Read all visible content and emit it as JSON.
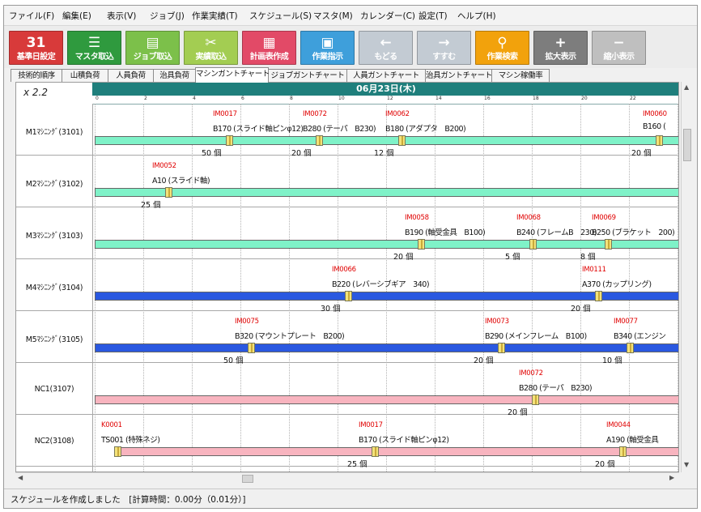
{
  "menu": [
    "ファイル(F)",
    "編集(E)",
    "表示(V)",
    "ジョブ(J)",
    "作業実績(T)",
    "スケジュール(S)",
    "マスタ(M)",
    "カレンダー(C)",
    "設定(T)",
    "ヘルプ(H)"
  ],
  "toolbar": [
    {
      "label": "基準日設定",
      "icon": "calendar-icon",
      "glyph": "31",
      "color": "#d83a3a"
    },
    {
      "label": "マスタ取込",
      "icon": "database-icon",
      "glyph": "☰",
      "color": "#2f9a3e"
    },
    {
      "label": "ジョブ取込",
      "icon": "document-icon",
      "glyph": "▤",
      "color": "#7cc04a"
    },
    {
      "label": "実績取込",
      "icon": "tools-icon",
      "glyph": "✂",
      "color": "#a3cd52"
    },
    {
      "label": "計画表作成",
      "icon": "gantt-icon",
      "glyph": "▦",
      "color": "#e24a67"
    },
    {
      "label": "作業指示",
      "icon": "clipboard-icon",
      "glyph": "▣",
      "color": "#3e9fdb"
    },
    {
      "label": "もどる",
      "icon": "arrow-left-icon",
      "glyph": "←",
      "color": "#c3cbd3"
    },
    {
      "label": "すすむ",
      "icon": "arrow-right-icon",
      "glyph": "→",
      "color": "#c3cbd3"
    },
    {
      "label": "作業検索",
      "icon": "search-icon",
      "glyph": "⚲",
      "color": "#f2a20c"
    },
    {
      "label": "拡大表示",
      "icon": "plus-icon",
      "glyph": "+",
      "color": "#7d7d7d"
    },
    {
      "label": "縮小表示",
      "icon": "minus-icon",
      "glyph": "−",
      "color": "#bfbfbf"
    }
  ],
  "tabs": [
    "技術的順序",
    "山積負荷",
    "人員負荷",
    "治具負荷",
    "マシンガントチャート",
    "ジョブガントチャート",
    "人員ガントチャート",
    "治具ガントチャート",
    "マシン稼働率"
  ],
  "active_tab": 4,
  "zoom": "x 2.2",
  "date_header": "06月23日(木)",
  "hours": [
    "0",
    "2",
    "4",
    "6",
    "8",
    "10",
    "12",
    "14",
    "16",
    "18",
    "20",
    "22"
  ],
  "colors": {
    "green_bar": "#7ff2c8",
    "blue_bar": "#2a58e0",
    "pink_bar": "#f8b4bf",
    "header": "#1f7f7c"
  },
  "machines": [
    {
      "label": "M1ﾏｼﾆﾝｸﾞ(3101)",
      "bar_color": "#7ff2c8",
      "bar_start_hour": 0,
      "jobs": [
        {
          "code": "IM0017",
          "desc": "B170 (スライド軸ピンφ12)",
          "qty": "50 個",
          "hour": 5.4
        },
        {
          "code": "IM0072",
          "desc": "B280 (テーパ　B230)",
          "qty": "20 個",
          "hour": 9.1
        },
        {
          "code": "IM0062",
          "desc": "B180 (アダプタ　B200)",
          "qty": "12 個",
          "hour": 12.5
        },
        {
          "code": "IM0060",
          "desc": "B160 (",
          "qty": "20 個",
          "hour": 23.1
        }
      ]
    },
    {
      "label": "M2ﾏｼﾆﾝｸﾞ(3102)",
      "bar_color": "#7ff2c8",
      "bar_start_hour": 0,
      "jobs": [
        {
          "code": "IM0052",
          "desc": "A10 (スライド軸)",
          "qty": "25 個",
          "hour": 2.9
        }
      ]
    },
    {
      "label": "M3ﾏｼﾆﾝｸﾞ(3103)",
      "bar_color": "#7ff2c8",
      "bar_start_hour": 0,
      "jobs": [
        {
          "code": "IM0058",
          "desc": "B190 (軸受金具　B100)",
          "qty": "20 個",
          "hour": 13.3
        },
        {
          "code": "IM0068",
          "desc": "B240 (フレームB　230)",
          "qty": "5 個",
          "hour": 17.9
        },
        {
          "code": "IM0069",
          "desc": "B250 (ブラケット　200)",
          "qty": "8 個",
          "hour": 21.0
        }
      ]
    },
    {
      "label": "M4ﾏｼﾆﾝｸﾞ(3104)",
      "bar_color": "#2a58e0",
      "bar_start_hour": 0,
      "jobs": [
        {
          "code": "IM0066",
          "desc": "B220 (レバーシブギア　340)",
          "qty": "30 個",
          "hour": 10.3
        },
        {
          "code": "IM0111",
          "desc": "A370 (カップリング)",
          "qty": "20 個",
          "hour": 20.6
        }
      ]
    },
    {
      "label": "M5ﾏｼﾆﾝｸﾞ(3105)",
      "bar_color": "#2a58e0",
      "bar_start_hour": 0,
      "jobs": [
        {
          "code": "IM0075",
          "desc": "B320 (マウントプレート　B200)",
          "qty": "50 個",
          "hour": 6.3
        },
        {
          "code": "IM0073",
          "desc": "B290 (メインフレーム　B100)",
          "qty": "20 個",
          "hour": 16.6
        },
        {
          "code": "IM0077",
          "desc": "B340 (エンジン",
          "qty": "10 個",
          "hour": 21.9
        }
      ]
    },
    {
      "label": "NC1(3107)",
      "bar_color": "#f8b4bf",
      "bar_start_hour": 0,
      "jobs": [
        {
          "code": "IM0072",
          "desc": "B280 (テーパ　B230)",
          "qty": "20 個",
          "hour": 18.0
        }
      ]
    },
    {
      "label": "NC2(3108)",
      "bar_color": "#f8b4bf",
      "bar_start_hour": 0.8,
      "jobs": [
        {
          "code": "K0001",
          "desc": "TS001 (特殊ネジ)",
          "qty": "",
          "hour": 0.8
        },
        {
          "code": "IM0017",
          "desc": "B170 (スライド軸ピンφ12)",
          "qty": "25 個",
          "hour": 11.4
        },
        {
          "code": "IM0044",
          "desc": "A190 (軸受金具",
          "qty": "20 個",
          "hour": 21.6
        }
      ]
    }
  ],
  "status": "スケジュールを作成しました　[計算時間：0.00分（0.01分）]"
}
